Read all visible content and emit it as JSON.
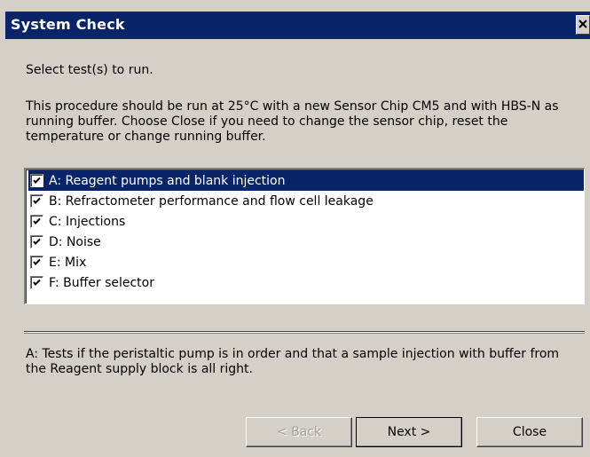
{
  "window": {
    "title": "System Check",
    "close_label": "✕"
  },
  "intro": "Select test(s) to run.",
  "description": "This procedure should be run at 25°C with a new Sensor Chip CM5 and with HBS-N as running buffer. Choose Close if you need to change the sensor chip, reset the temperature or change running buffer.",
  "tests": [
    {
      "label": "A: Reagent pumps and blank injection",
      "checked": true,
      "selected": true
    },
    {
      "label": "B: Refractometer performance and flow cell leakage",
      "checked": true,
      "selected": false
    },
    {
      "label": "C: Injections",
      "checked": true,
      "selected": false
    },
    {
      "label": "D: Noise",
      "checked": true,
      "selected": false
    },
    {
      "label": "E: Mix",
      "checked": true,
      "selected": false
    },
    {
      "label": "F: Buffer selector",
      "checked": true,
      "selected": false
    }
  ],
  "info": "A: Tests if the peristaltic pump is in order and that a sample injection with buffer from the Reagent supply block is all right.",
  "buttons": {
    "back": "< Back",
    "next": "Next >",
    "close": "Close"
  },
  "colors": {
    "title_bar": "#0a246a",
    "dialog_bg": "#d4d0c8",
    "selection": "#0a246a"
  }
}
